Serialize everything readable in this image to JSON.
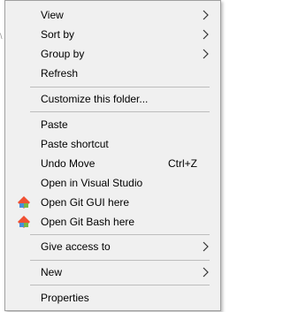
{
  "background": {
    "text": "\\"
  },
  "menu": {
    "view": "View",
    "sort_by": "Sort by",
    "group_by": "Group by",
    "refresh": "Refresh",
    "customize": "Customize this folder...",
    "paste": "Paste",
    "paste_shortcut": "Paste shortcut",
    "undo_move": "Undo Move",
    "undo_move_shortcut": "Ctrl+Z",
    "open_vs": "Open in Visual Studio",
    "open_git_gui": "Open Git GUI here",
    "open_git_bash": "Open Git Bash here",
    "give_access": "Give access to",
    "new": "New",
    "properties": "Properties"
  },
  "icons": {
    "git_gui": "git-gui-icon",
    "git_bash": "git-bash-icon",
    "submenu": "chevron-right-icon"
  },
  "colors": {
    "git_orange": "#f05033",
    "git_blue": "#4a90d9",
    "git_green": "#78b844"
  }
}
